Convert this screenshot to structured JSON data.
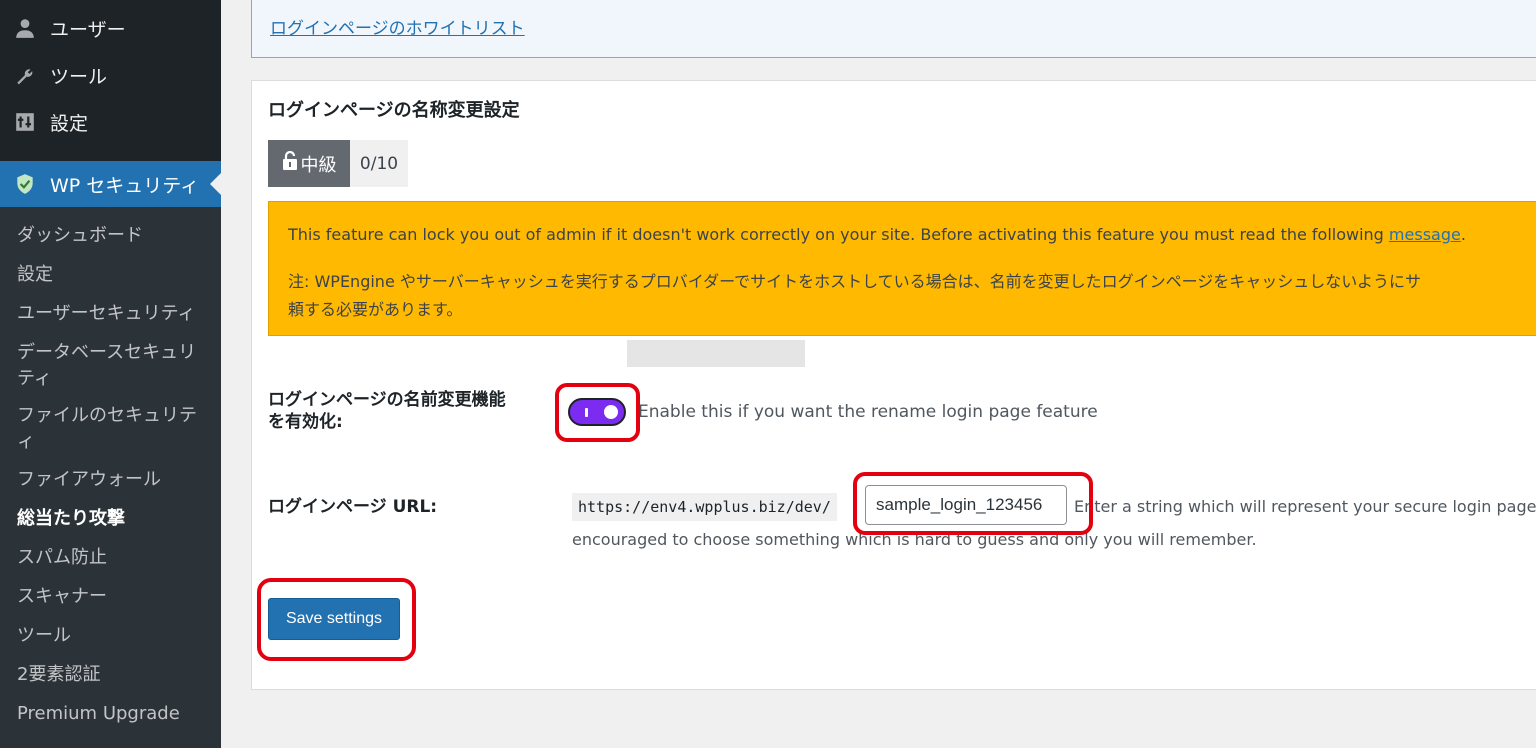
{
  "sidebar": {
    "top_items": [
      {
        "label": "ユーザー",
        "icon": "user-icon"
      },
      {
        "label": "ツール",
        "icon": "wrench-icon"
      },
      {
        "label": "設定",
        "icon": "settings-icon"
      }
    ],
    "active_item": {
      "label": "WP セキュリティ",
      "icon": "shield-icon"
    },
    "submenu": [
      {
        "label": "ダッシュボード"
      },
      {
        "label": "設定"
      },
      {
        "label": "ユーザーセキュリティ"
      },
      {
        "label": "データベースセキュリティ"
      },
      {
        "label": "ファイルのセキュリティ"
      },
      {
        "label": "ファイアウォール"
      },
      {
        "label": "総当たり攻撃"
      },
      {
        "label": "スパム防止"
      },
      {
        "label": "スキャナー"
      },
      {
        "label": "ツール"
      },
      {
        "label": "2要素認証"
      },
      {
        "label": "Premium Upgrade"
      }
    ],
    "current_submenu": "総当たり攻撃"
  },
  "notice": {
    "link_text": "ログインページのホワイトリスト"
  },
  "section": {
    "title": "ログインページの名称変更設定",
    "badge_level": "中級",
    "badge_score": "0/10",
    "badge_icon": "lock-icon"
  },
  "warning": {
    "line1_text": "This feature can lock you out of admin if it doesn't work correctly on your site. Before activating this feature you must read the following ",
    "line1_link": "message",
    "line1_end": ".",
    "line2": "注: WPEngine やサーバーキャッシュを実行するプロバイダーでサイトをホストしている場合は、名前を変更したログインページをキャッシュしないようにサ",
    "line3": "頼する必要があります。"
  },
  "form": {
    "enable_label_line1": "ログインページの名前変更機能",
    "enable_label_line2": "を有効化:",
    "enable_toggle_on": true,
    "enable_desc": "Enable this if you want the rename login page feature",
    "url_label": "ログインページ URL:",
    "url_prefix": "https://env4.wpplus.biz/dev/",
    "url_value": "sample_login_123456",
    "url_desc_line1": "Enter a string which will represent your secure login page s",
    "url_desc_line2": "encouraged to choose something which is hard to guess and only you will remember.",
    "save_label": "Save settings"
  },
  "colors": {
    "sidebar_bg": "#1d2327",
    "active_blue": "#2271b1",
    "warning_yellow": "#ffb900",
    "toggle_purple": "#7b2cf0",
    "highlight_red": "#e3000f"
  }
}
